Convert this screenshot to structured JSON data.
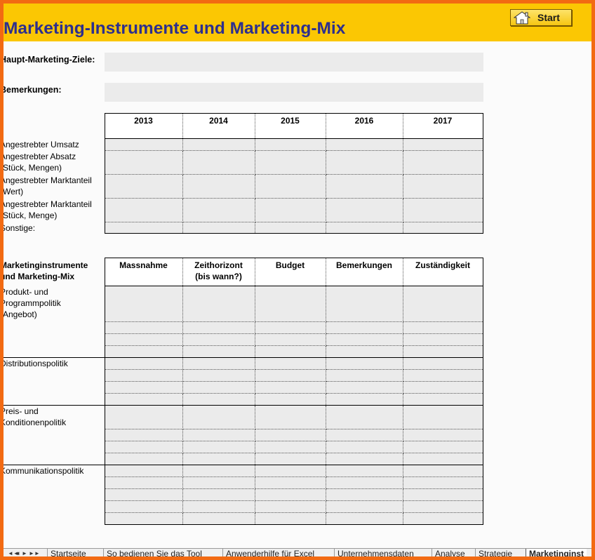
{
  "header": {
    "title": "Marketing-Instrumente und Marketing-Mix",
    "start_label": "Start"
  },
  "fields": {
    "ziele_label": "Haupt-Marketing-Ziele:",
    "bemerkungen_label": "Bemerkungen:"
  },
  "targets": {
    "years": [
      "2013",
      "2014",
      "2015",
      "2016",
      "2017"
    ],
    "rows": [
      {
        "lines": [
          "Angestrebter Umsatz"
        ]
      },
      {
        "lines": [
          "Angestrebter Absatz",
          "(Stück, Mengen)"
        ]
      },
      {
        "lines": [
          "Angestrebter Marktanteil",
          "(Wert)"
        ]
      },
      {
        "lines": [
          "Angestrebter Marktanteil",
          "(Stück, Menge)"
        ]
      },
      {
        "lines": [
          "Sonstige:"
        ]
      }
    ]
  },
  "instruments": {
    "header_lines": [
      "Marketinginstrumente",
      "und Marketing-Mix"
    ],
    "columns": [
      {
        "lines": [
          "Massnahme"
        ]
      },
      {
        "lines": [
          "Zeithorizont",
          "(bis wann?)"
        ]
      },
      {
        "lines": [
          "Budget"
        ]
      },
      {
        "lines": [
          "Bemerkungen"
        ]
      },
      {
        "lines": [
          "Zuständigkeit"
        ]
      }
    ],
    "groups": [
      {
        "lines": [
          "Produkt- und",
          "Programmpolitik",
          "(Angebot)"
        ]
      },
      {
        "lines": [
          "Distributionspolitik"
        ]
      },
      {
        "lines": [
          "Preis- und",
          "Konditionenpolitik"
        ]
      },
      {
        "lines": [
          "Kommunikationspolitik"
        ]
      }
    ]
  },
  "sheet_tabs": {
    "nav": [
      "◄◄",
      "◄",
      "►",
      "►►"
    ],
    "tabs": [
      "Startseite",
      "So bedienen Sie das Tool",
      "Anwenderhilfe für Excel",
      "Unternehmensdaten",
      "Analyse",
      "Strategie",
      "Marketinginst"
    ]
  }
}
